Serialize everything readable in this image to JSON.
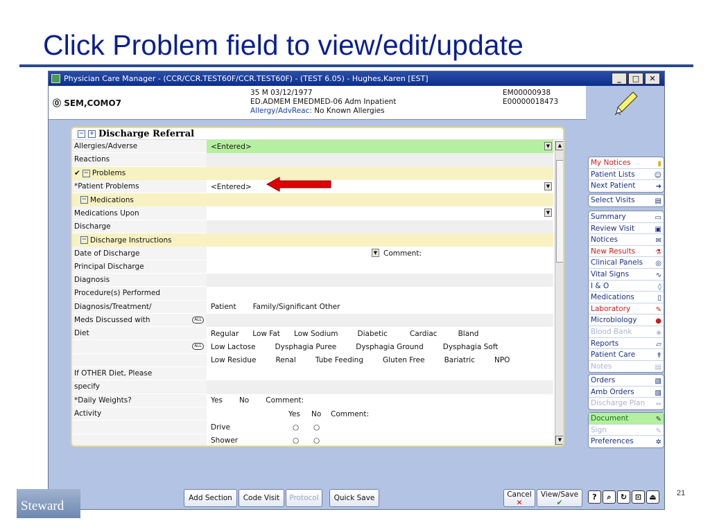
{
  "slide": {
    "title": "Click Problem field to view/edit/update",
    "logo": "Steward",
    "page_number": "21"
  },
  "window": {
    "title": "Physician Care Manager -  (CCR/CCR.TEST60F/CCR.TEST60F) - (TEST 6.05) - Hughes,Karen [EST]",
    "minimize": "_",
    "maximize": "□",
    "close": "✕"
  },
  "patient": {
    "name": "SEM,COMO7",
    "demographics": "35 M 03/12/1977",
    "location": "ED.ADMEM EMEDMED-06   Adm Inpatient",
    "allergy_label": "Allergy/AdvReac:",
    "allergy_value": "No Known Allergies",
    "id1": "EM00000938",
    "id2": "E00000018473"
  },
  "form": {
    "title": "Discharge Referral",
    "allergies_label_1": "Allergies/Adverse",
    "allergies_label_2": "Reactions",
    "allergies_value": "<Entered>",
    "section_problems": "Problems",
    "patient_problems_label": "*Patient Problems",
    "patient_problems_value": "<Entered>",
    "section_medications": "Medications",
    "meds_label_1": "Medications Upon",
    "meds_label_2": "Discharge",
    "section_discharge": "Discharge Instructions",
    "date_label": "Date of Discharge",
    "comment_label": "Comment:",
    "principal_label_1": "Principal Discharge",
    "principal_label_2": "Diagnosis",
    "procedures_label": "Procedure(s) Performed",
    "diag_label_1": "Diagnosis/Treatment/",
    "diag_label_2": "Meds Discussed with",
    "all_badge": "ALL",
    "diag_options": [
      "Patient",
      "Family/Significant Other"
    ],
    "diet_label": "Diet",
    "diet_row1": [
      "Regular",
      "Low Fat",
      "Low Sodium",
      "Diabetic",
      "Cardiac",
      "Bland"
    ],
    "diet_row2": [
      "Low Lactose",
      "Dysphagia Puree",
      "Dysphagia Ground",
      "Dysphagia Soft"
    ],
    "diet_row3": [
      "Low Residue",
      "Renal",
      "Tube Feeding",
      "Gluten Free",
      "Bariatric",
      "NPO"
    ],
    "other_diet_label_1": "If OTHER Diet, Please",
    "other_diet_label_2": "specify",
    "weights_label": "*Daily Weights?",
    "weights_yes": "Yes",
    "weights_no": "No",
    "weights_comment": "Comment:",
    "activity_label": "Activity",
    "activity_yes": "Yes",
    "activity_no": "No",
    "activity_comment": "Comment:",
    "activities": [
      "Drive",
      "Shower"
    ]
  },
  "bottom_buttons": {
    "add_section": "Add Section",
    "code_visit": "Code Visit",
    "protocol": "Protocol",
    "quick_save": "Quick Save",
    "cancel": "Cancel",
    "view_save": "View/Save"
  },
  "nav": {
    "group1": [
      "My Notices",
      "Patient Lists",
      "Next Patient"
    ],
    "group2": [
      "Select Visits"
    ],
    "group3": [
      "Summary",
      "Review Visit",
      "Notices",
      "New Results",
      "Clinical Panels",
      "Vital Signs",
      "I & O",
      "Medications",
      "Laboratory",
      "Microbiology",
      "Blood Bank",
      "Reports",
      "Patient Care",
      "Notes"
    ],
    "group4": [
      "Orders",
      "Amb Orders",
      "Discharge Plan"
    ],
    "group5": [
      "Document",
      "Sign",
      "Preferences"
    ]
  },
  "colors": {
    "slide_title": "#0a1f8f",
    "window_bg": "#b3c3e3",
    "highlight_green": "#b4f0a0",
    "section_yellow": "#f8f2c2",
    "arrow_red": "#e00000"
  }
}
